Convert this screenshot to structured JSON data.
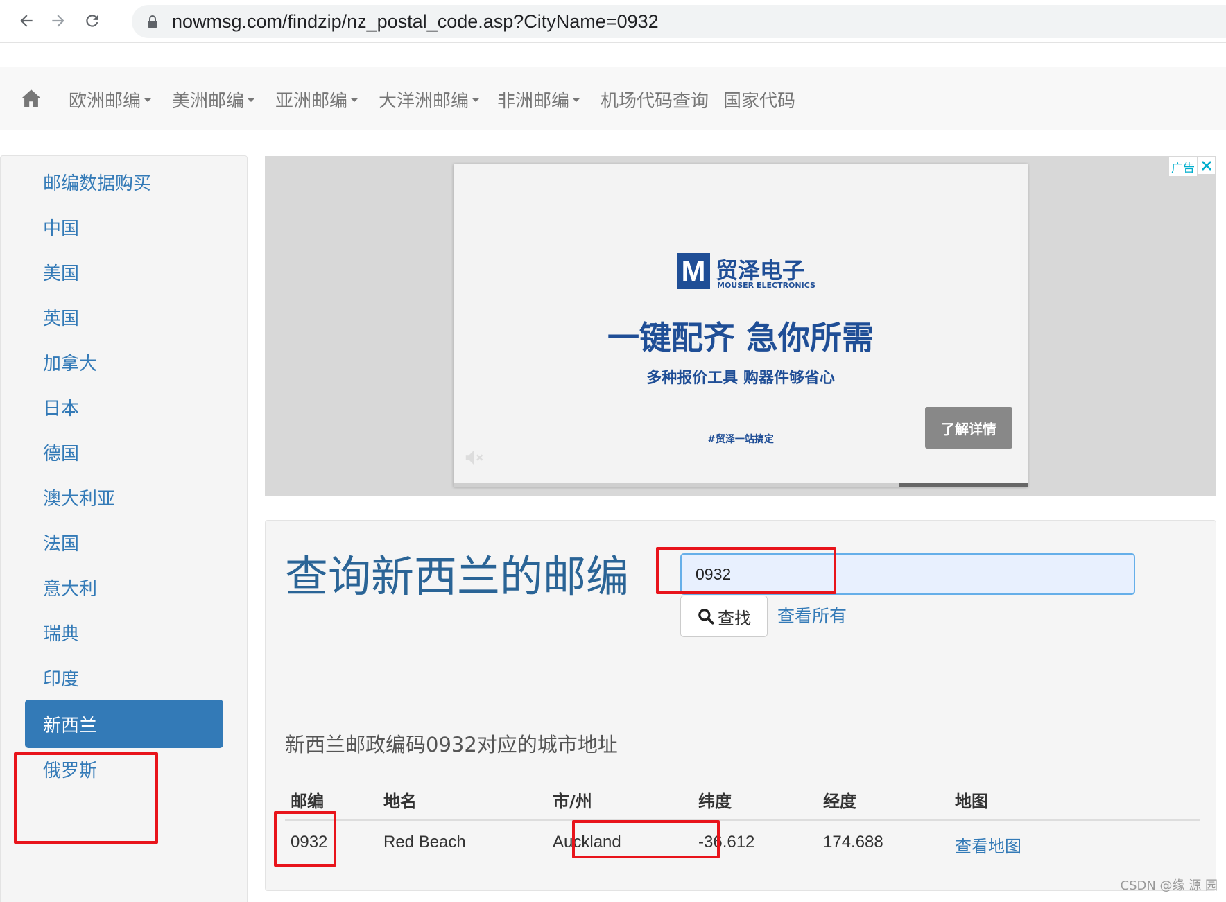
{
  "browser": {
    "url": "nowmsg.com/findzip/nz_postal_code.asp?CityName=0932"
  },
  "navbar": {
    "items": [
      {
        "label": "欧洲邮编",
        "dropdown": true
      },
      {
        "label": "美洲邮编",
        "dropdown": true
      },
      {
        "label": "亚洲邮编",
        "dropdown": true
      },
      {
        "label": "大洋洲邮编",
        "dropdown": true
      },
      {
        "label": "非洲邮编",
        "dropdown": true
      },
      {
        "label": "机场代码查询",
        "dropdown": false
      },
      {
        "label": "国家代码",
        "dropdown": false
      }
    ]
  },
  "sidebar": {
    "items": [
      {
        "label": "邮编数据购买"
      },
      {
        "label": "中国"
      },
      {
        "label": "美国"
      },
      {
        "label": "英国"
      },
      {
        "label": "加拿大"
      },
      {
        "label": "日本"
      },
      {
        "label": "德国"
      },
      {
        "label": "澳大利亚"
      },
      {
        "label": "法国"
      },
      {
        "label": "意大利"
      },
      {
        "label": "瑞典"
      },
      {
        "label": "印度"
      },
      {
        "label": "新西兰",
        "active": true
      },
      {
        "label": "俄罗斯"
      }
    ]
  },
  "ad": {
    "label": "广告",
    "brand_cn": "贸泽电子",
    "brand_en": "MOUSER ELECTRONICS",
    "brand_mark": "M",
    "headline": "一键配齐  急你所需",
    "sub": "多种报价工具   购器件够省心",
    "tag": "#贸泽一站搞定",
    "cta": "了解详情"
  },
  "main": {
    "title": "查询新西兰的邮编",
    "search_value": "0932",
    "search_button": "查找",
    "view_all": "查看所有",
    "result_heading": "新西兰邮政编码0932对应的城市地址",
    "table": {
      "headers": [
        "邮编",
        "地名",
        "市/州",
        "纬度",
        "经度",
        "地图"
      ],
      "rows": [
        [
          "0932",
          "Red Beach",
          "Auckland",
          "-36.612",
          "174.688",
          "查看地图"
        ]
      ]
    }
  },
  "watermark": "CSDN @缘  源  园",
  "colors": {
    "link": "#337ab7",
    "title": "#2a6496",
    "annotation": "#e8141b",
    "brand": "#1f4e96"
  }
}
